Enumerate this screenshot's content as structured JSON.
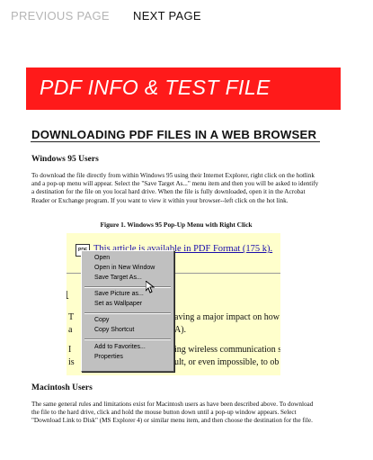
{
  "nav": {
    "previous_label": "PREVIOUS PAGE",
    "next_label": "NEXT PAGE"
  },
  "banner": {
    "title": "PDF INFO & TEST FILE",
    "color": "#ff1a1a"
  },
  "document": {
    "title": "DOWNLOADING PDF FILES IN A WEB BROWSER",
    "sections": [
      {
        "heading": "Windows 95 Users",
        "paragraph": "To download the file directly from within Windows 95 using their Internet Explorer, right click on the hotlink and a pop-up menu will appear. Select the \"Save Target As...\" menu item and then you will be asked to identify a destination for the file on you local hard drive. When the file is fully downloaded, open it in the Acrobat Reader or Exchange program. If you want to view it within your browser--left click on the hot link."
      },
      {
        "heading": "Macintosh Users",
        "paragraph": "The same general rules and limitations exist for Macintosh users as have been described above. To download the file to the hard drive, click and hold the mouse button down until a pop-up window appears. Select \"Download Link to Disk\" (MS Explorer 4) or similar menu item, and then choose the destination for the file."
      }
    ],
    "figure_caption": "Figure 1. Windows 95 Pop-Up Menu with Right Click"
  },
  "figure": {
    "icon_text": "PDF",
    "link_text": "This article is available in PDF Format (175 k).",
    "section_number": "1",
    "body_lines": [
      "T",
      "a",
      "I",
      "is"
    ],
    "body_fragments": [
      "aving a major impact on how",
      "A).",
      "ing wireless communication s",
      "ult, or even impossible, to ob"
    ],
    "context_menu": [
      "Open",
      "Open in New Window",
      "Save Target As...",
      "Save Picture as...",
      "Set as Wallpaper",
      "Copy",
      "Copy Shortcut",
      "Add to Favorites...",
      "Properties"
    ]
  }
}
